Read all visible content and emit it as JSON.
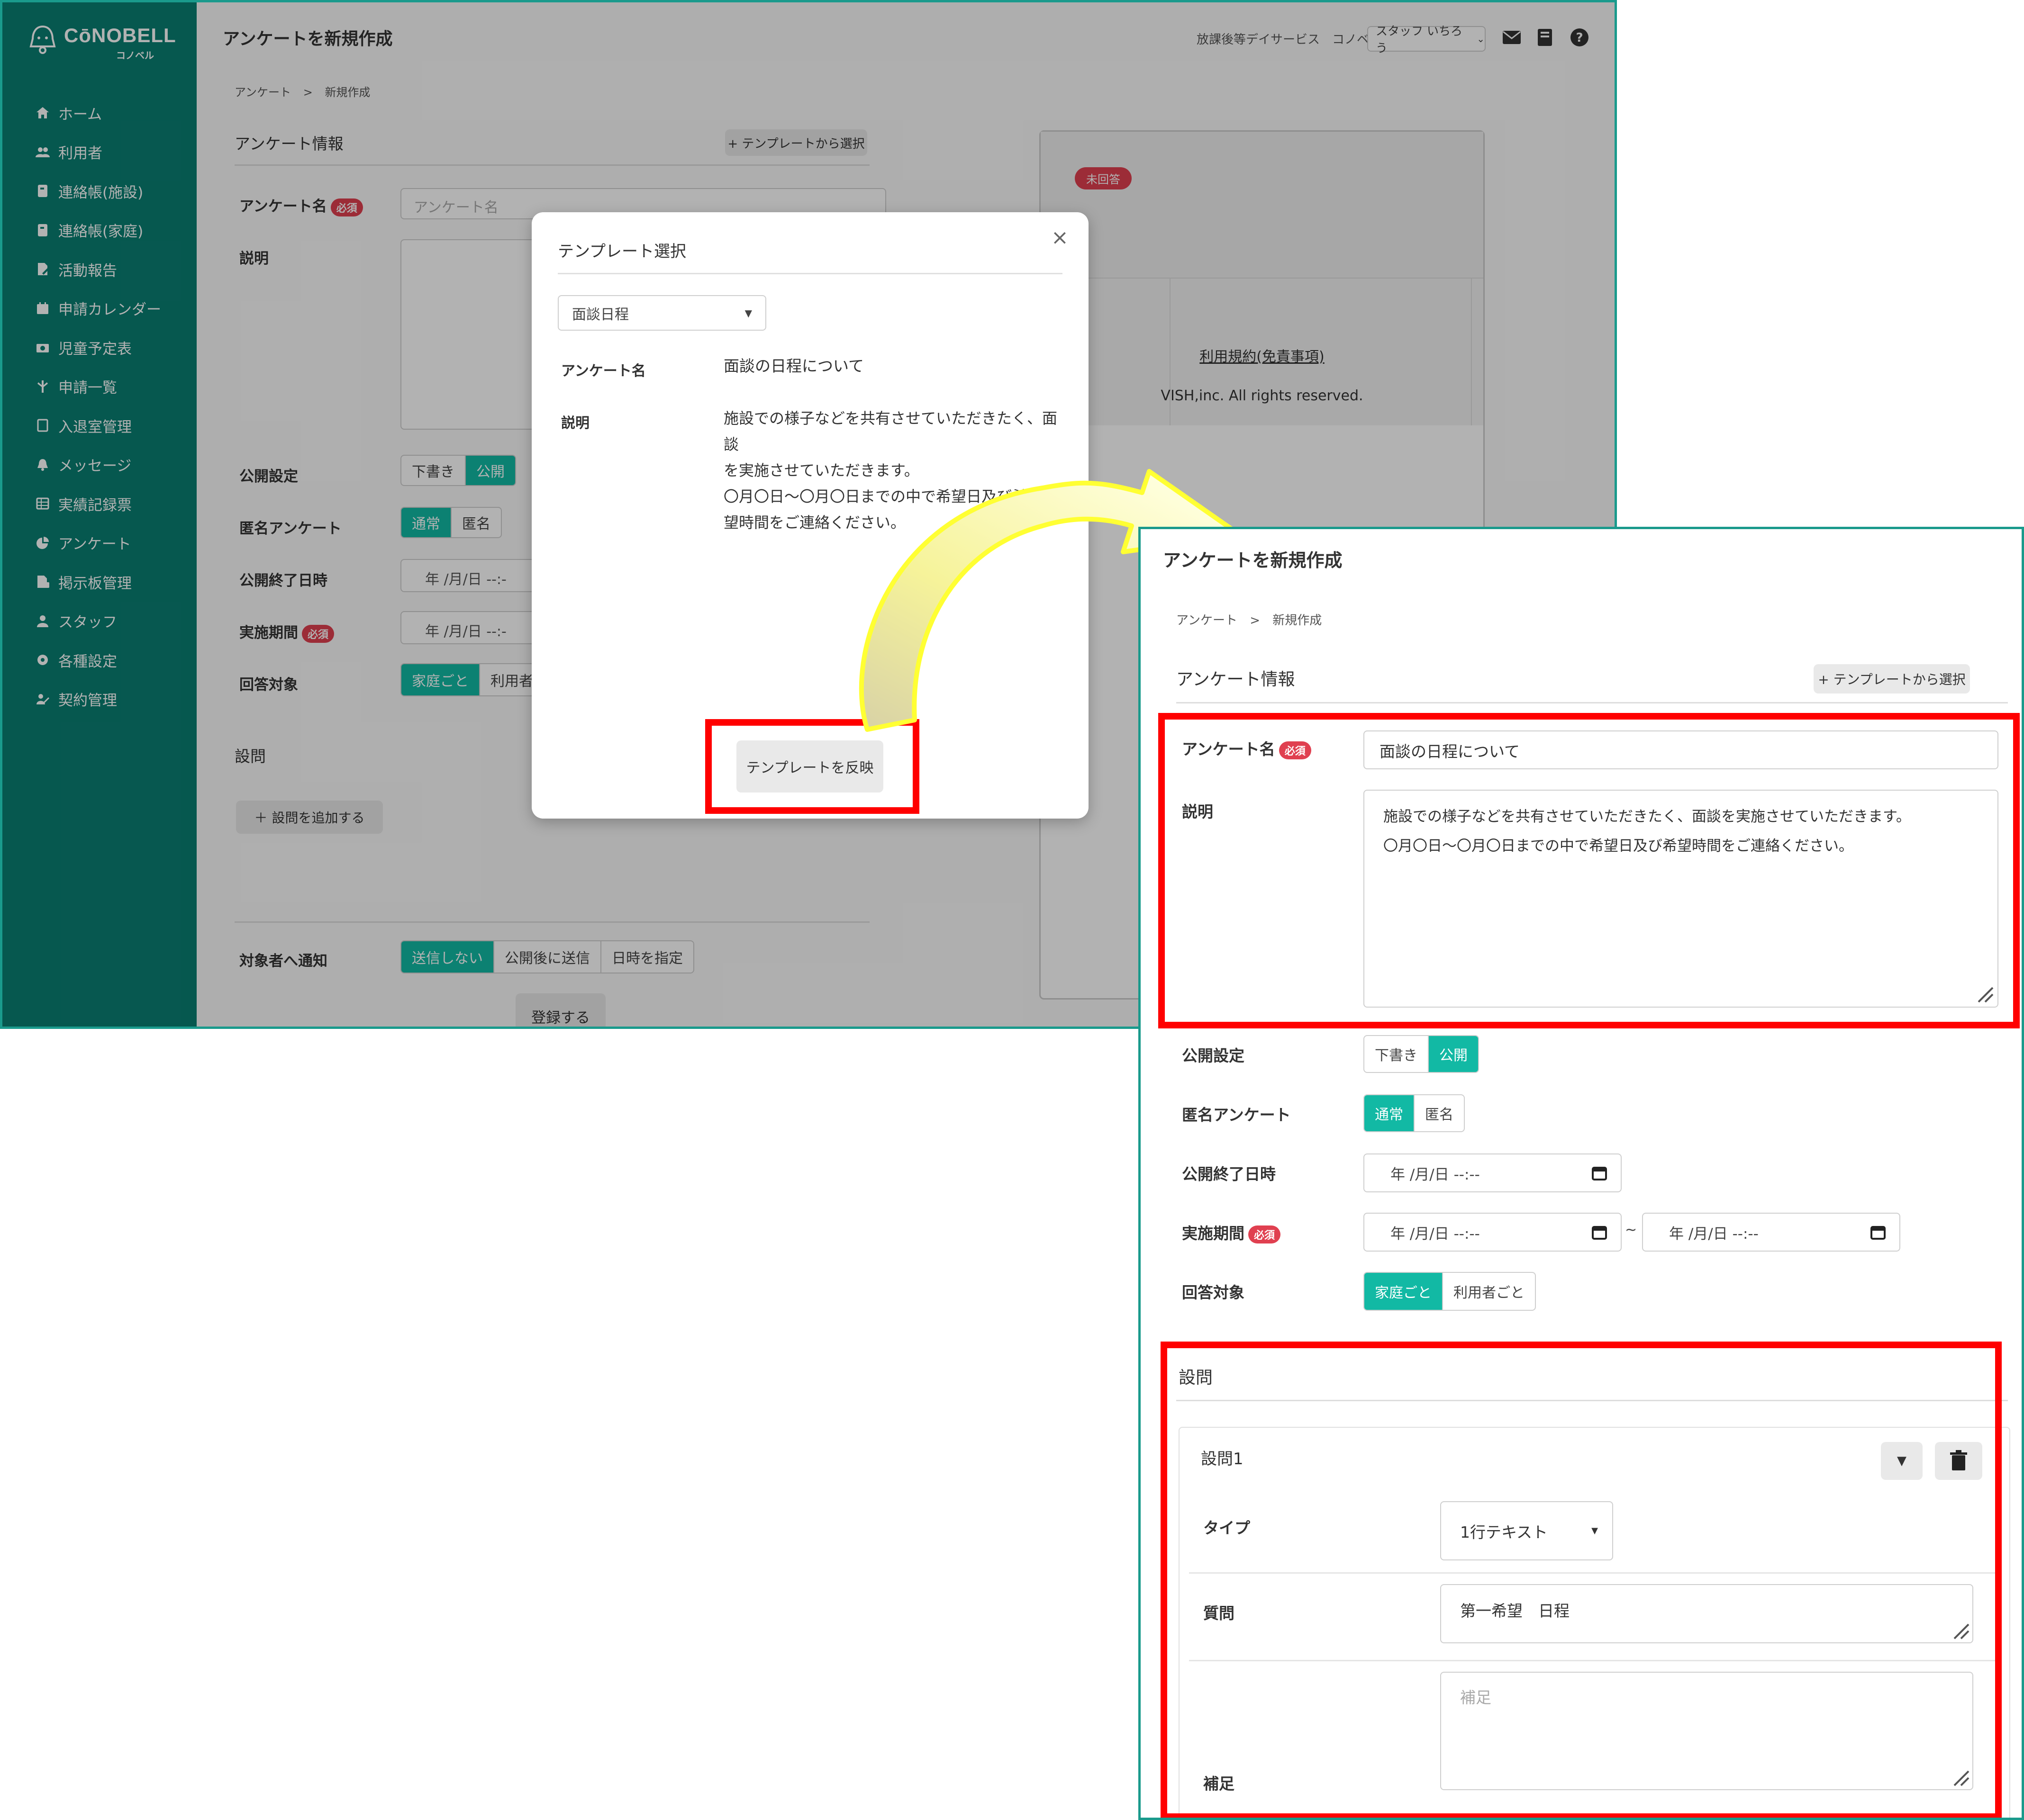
{
  "brand": {
    "name": "CōNOBELL",
    "sub": "コノベル"
  },
  "sidebar": {
    "items": [
      {
        "label": "ホーム",
        "icon": "home-icon"
      },
      {
        "label": "利用者",
        "icon": "users-icon"
      },
      {
        "label": "連絡帳(施設)",
        "icon": "notebook-icon"
      },
      {
        "label": "連絡帳(家庭)",
        "icon": "notebook-icon"
      },
      {
        "label": "活動報告",
        "icon": "report-icon"
      },
      {
        "label": "申請カレンダー",
        "icon": "calendar-icon"
      },
      {
        "label": "児童予定表",
        "icon": "schedule-icon"
      },
      {
        "label": "申請一覧",
        "icon": "list-icon"
      },
      {
        "label": "入退室管理",
        "icon": "door-icon"
      },
      {
        "label": "メッセージ",
        "icon": "bell-icon"
      },
      {
        "label": "実績記録票",
        "icon": "table-icon"
      },
      {
        "label": "アンケート",
        "icon": "pie-chart-icon"
      },
      {
        "label": "掲示板管理",
        "icon": "board-icon"
      },
      {
        "label": "スタッフ",
        "icon": "staff-icon"
      },
      {
        "label": "各種設定",
        "icon": "gear-icon"
      },
      {
        "label": "契約管理",
        "icon": "contract-icon"
      }
    ]
  },
  "header": {
    "title": "アンケートを新規作成",
    "facility": "放課後等デイサービス　コノベル",
    "user": "スタッフ いちろう"
  },
  "breadcrumb": {
    "parent": "アンケート",
    "sep": ">",
    "current": "新規作成"
  },
  "form": {
    "section_info": "アンケート情報",
    "template_btn": "+ テンプレートから選択",
    "name_label": "アンケート名",
    "required": "必須",
    "name_placeholder": "アンケート名",
    "desc_label": "説明",
    "publish_label": "公開設定",
    "publish_opts": [
      "下書き",
      "公開"
    ],
    "anon_label": "匿名アンケート",
    "anon_opts": [
      "通常",
      "匿名"
    ],
    "end_label": "公開終了日時",
    "date_placeholder": "年 /月/日 --:--",
    "period_label": "実施期間",
    "period_sep": "~",
    "target_label": "回答対象",
    "target_opts": [
      "家庭ごと",
      "利用者ごと"
    ],
    "target_opts_cut": [
      "家庭ごと",
      "利用者"
    ],
    "date_cut": "年 /月/日 --:-",
    "questions_label": "設問",
    "add_question": "＋ 設問を追加する",
    "notify_label": "対象者へ通知",
    "notify_opts": [
      "送信しない",
      "公開後に送信",
      "日時を指定"
    ],
    "submit": "登録する"
  },
  "preview": {
    "badge": "未回答",
    "terms": "利用規約(免責事項)",
    "copyright": "VISH,inc. All rights reserved."
  },
  "modal": {
    "title": "テンプレート選択",
    "close": "×",
    "select_value": "面談日程",
    "name_label": "アンケート名",
    "name_value": "面談の日程について",
    "desc_label": "説明",
    "desc_lines": [
      "施設での様子などを共有させていただきたく、面談",
      "を実施させていただきます。",
      "〇月〇日～〇月〇日までの中で希望日及び希",
      "望時間をご連絡ください。"
    ],
    "apply_btn": "テンプレートを反映"
  },
  "result": {
    "name_value": "面談の日程について",
    "desc_lines": [
      "施設での様子などを共有させていただきたく、面談を実施させていただきます。",
      "〇月〇日～〇月〇日までの中で希望日及び希望時間をご連絡ください。"
    ],
    "q_title": "設問1",
    "type_label": "タイプ",
    "type_value": "1行テキスト",
    "question_label": "質問",
    "question_value": "第一希望　日程",
    "note_label": "補足",
    "note_placeholder": "補足"
  },
  "colors": {
    "brand": "#0a7e72",
    "accent": "#12b9a4",
    "required": "#e04050",
    "highlight": "#ff0000",
    "arrow": "#ffff33"
  }
}
